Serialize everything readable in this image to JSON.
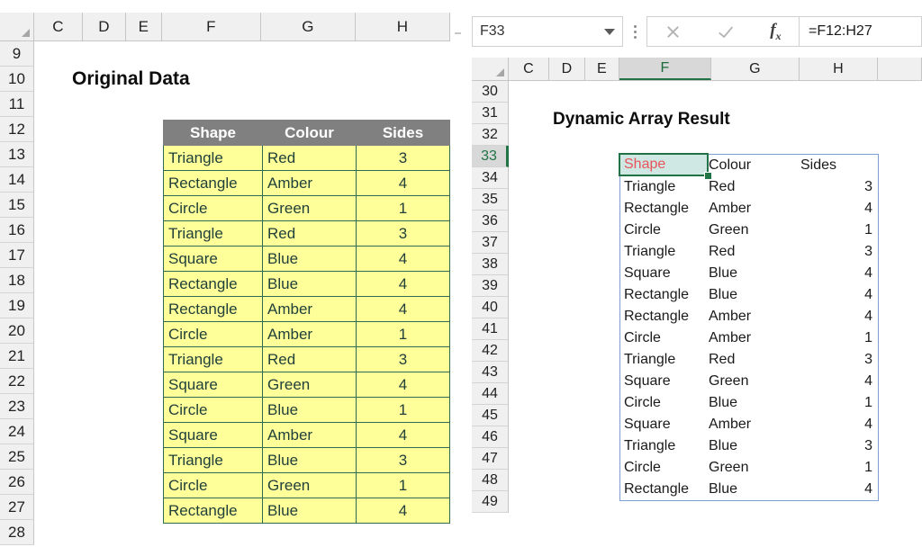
{
  "app": {
    "type": "spreadsheet",
    "accent_green": "#217346",
    "header_grey": "#808080",
    "cell_yellow": "#ffff99",
    "selected_fill": "#cfe8e4",
    "selected_text": "#e8545a",
    "spill_border": "#7f9fd4"
  },
  "left_pane": {
    "title": "Original Data",
    "column_headers": [
      "C",
      "D",
      "E",
      "F",
      "G",
      "H"
    ],
    "row_headers": [
      "9",
      "10",
      "11",
      "12",
      "13",
      "14",
      "15",
      "16",
      "17",
      "18",
      "19",
      "20",
      "21",
      "22",
      "23",
      "24",
      "25",
      "26",
      "27",
      "28"
    ],
    "table": {
      "headers": [
        "Shape",
        "Colour",
        "Sides"
      ],
      "rows": [
        [
          "Triangle",
          "Red",
          "3"
        ],
        [
          "Rectangle",
          "Amber",
          "4"
        ],
        [
          "Circle",
          "Green",
          "1"
        ],
        [
          "Triangle",
          "Red",
          "3"
        ],
        [
          "Square",
          "Blue",
          "4"
        ],
        [
          "Rectangle",
          "Blue",
          "4"
        ],
        [
          "Rectangle",
          "Amber",
          "4"
        ],
        [
          "Circle",
          "Amber",
          "1"
        ],
        [
          "Triangle",
          "Red",
          "3"
        ],
        [
          "Square",
          "Green",
          "4"
        ],
        [
          "Circle",
          "Blue",
          "1"
        ],
        [
          "Square",
          "Amber",
          "4"
        ],
        [
          "Triangle",
          "Blue",
          "3"
        ],
        [
          "Circle",
          "Green",
          "1"
        ],
        [
          "Rectangle",
          "Blue",
          "4"
        ]
      ]
    }
  },
  "right_pane": {
    "title": "Dynamic Array Result",
    "column_headers": [
      "C",
      "D",
      "E",
      "F",
      "G",
      "H"
    ],
    "selected_column": "F",
    "row_headers": [
      "30",
      "31",
      "32",
      "33",
      "34",
      "35",
      "36",
      "37",
      "38",
      "39",
      "40",
      "41",
      "42",
      "43",
      "44",
      "45",
      "46",
      "47",
      "48",
      "49"
    ],
    "selected_row": "33",
    "formula_bar": {
      "name_box": "F33",
      "formula": "=F12:H27",
      "cancel_icon": "close-x-icon",
      "confirm_icon": "check-icon",
      "function_icon": "fx-icon",
      "menu_icon": "vertical-dots-icon",
      "dropdown_icon": "chevron-down-icon"
    },
    "selected_cell": {
      "reference": "F33",
      "value": "Shape"
    },
    "spill": {
      "headers": [
        "Shape",
        "Colour",
        "Sides"
      ],
      "rows": [
        [
          "Triangle",
          "Red",
          "3"
        ],
        [
          "Rectangle",
          "Amber",
          "4"
        ],
        [
          "Circle",
          "Green",
          "1"
        ],
        [
          "Triangle",
          "Red",
          "3"
        ],
        [
          "Square",
          "Blue",
          "4"
        ],
        [
          "Rectangle",
          "Blue",
          "4"
        ],
        [
          "Rectangle",
          "Amber",
          "4"
        ],
        [
          "Circle",
          "Amber",
          "1"
        ],
        [
          "Triangle",
          "Red",
          "3"
        ],
        [
          "Square",
          "Green",
          "4"
        ],
        [
          "Circle",
          "Blue",
          "1"
        ],
        [
          "Square",
          "Amber",
          "4"
        ],
        [
          "Triangle",
          "Blue",
          "3"
        ],
        [
          "Circle",
          "Green",
          "1"
        ],
        [
          "Rectangle",
          "Blue",
          "4"
        ]
      ]
    }
  }
}
